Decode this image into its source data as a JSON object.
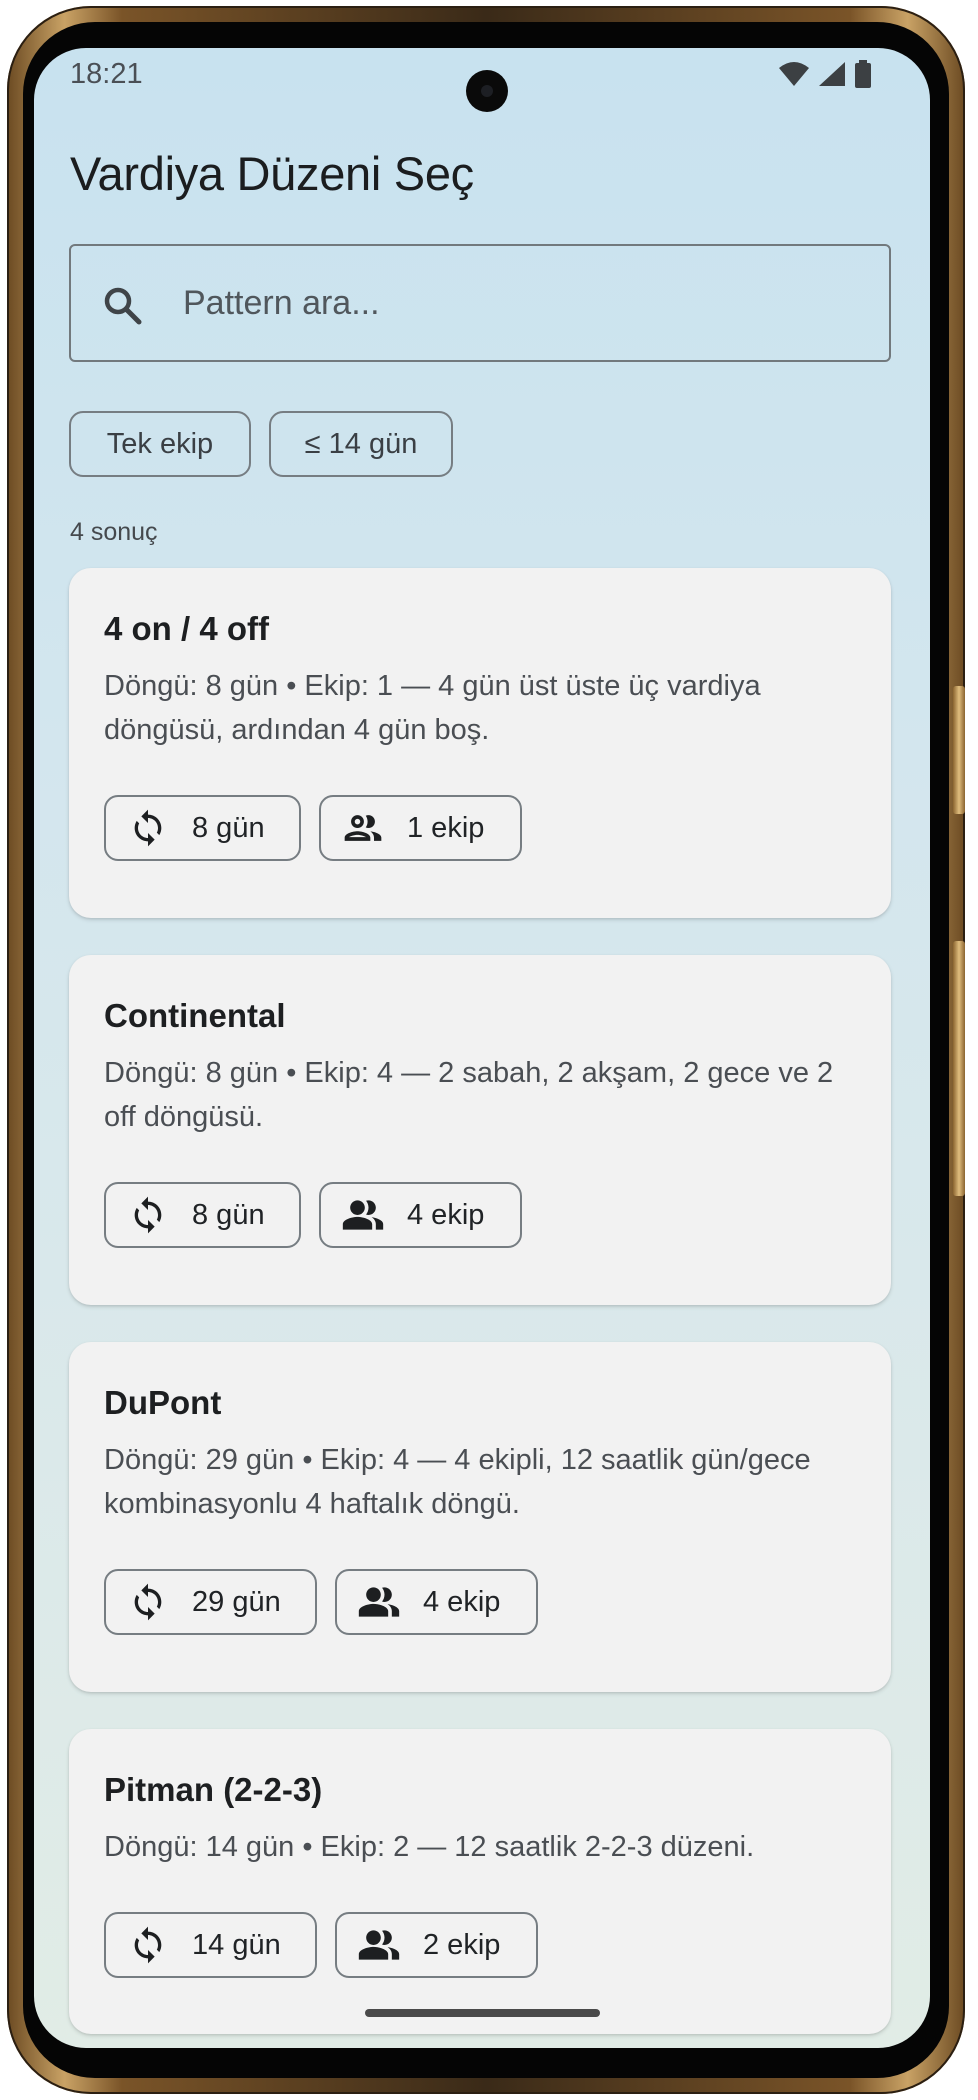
{
  "status_bar": {
    "time": "18:21",
    "icons": [
      "wifi-icon",
      "cellular-signal-icon",
      "battery-icon"
    ]
  },
  "header": {
    "title": "Vardiya Düzeni Seç"
  },
  "search": {
    "placeholder": "Pattern ara...",
    "value": "",
    "icon": "search-icon"
  },
  "filters": [
    {
      "label": "Tek ekip"
    },
    {
      "label": "≤ 14 gün"
    }
  ],
  "results": {
    "count_label": "4 sonuç"
  },
  "patterns": [
    {
      "title": "4 on / 4 off",
      "description": "Döngü: 8 gün • Ekip: 1 — 4 gün üst üste üç vardiya döngüsü, ardından 4 gün boş.",
      "cycle_label": "8 gün",
      "teams_label": "1 ekip"
    },
    {
      "title": "Continental",
      "description": "Döngü: 8 gün • Ekip: 4 — 2 sabah, 2 akşam, 2 gece ve 2 off döngüsü.",
      "cycle_label": "8 gün",
      "teams_label": "4 ekip"
    },
    {
      "title": "DuPont",
      "description": "Döngü: 29 gün • Ekip: 4 — 4 ekipli, 12 saatlik gün/gece kombinasyonlu 4 haftalık döngü.",
      "cycle_label": "29 gün",
      "teams_label": "4 ekip"
    },
    {
      "title": "Pitman (2-2-3)",
      "description": "Döngü: 14 gün • Ekip: 2 — 12 saatlik 2-2-3 düzeni.",
      "cycle_label": "14 gün",
      "teams_label": "2 ekip"
    }
  ],
  "icons": {
    "cycle": "sync-icon",
    "teams": "group-icon"
  }
}
